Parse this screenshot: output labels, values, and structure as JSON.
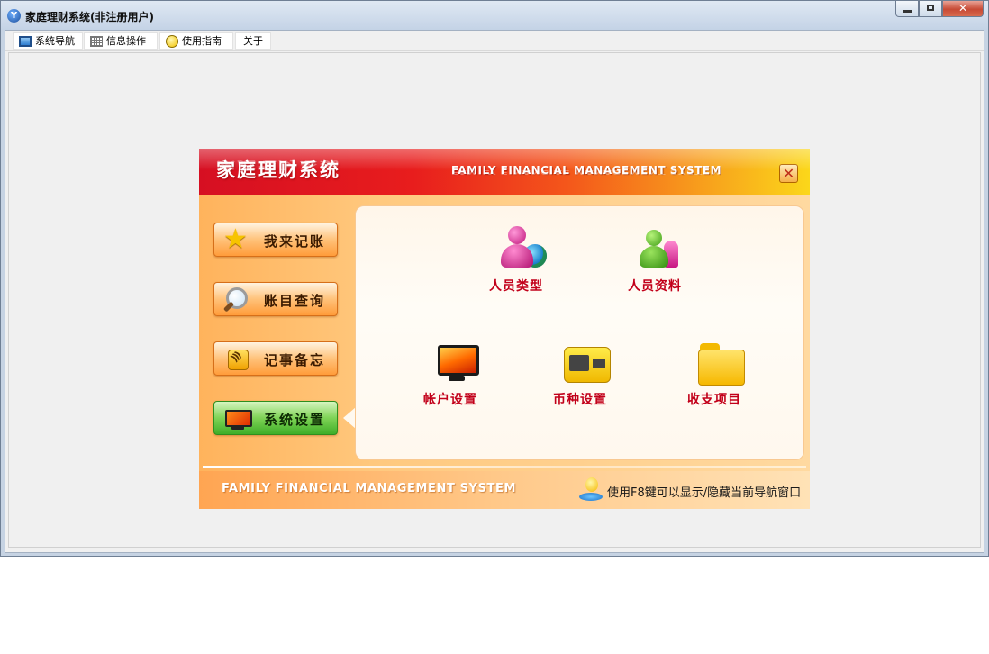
{
  "window": {
    "title": "家庭理财系统(非注册用户)",
    "app_icon_letter": "Y",
    "controls": {
      "minimize": "minimize",
      "maximize": "maximize",
      "close": "✕"
    }
  },
  "menubar": {
    "items": [
      {
        "label": "系统导航",
        "icon": "monitor-icon"
      },
      {
        "label": "信息操作",
        "icon": "grid-icon"
      },
      {
        "label": "使用指南",
        "icon": "smiley-icon"
      },
      {
        "label": "关于",
        "icon": ""
      }
    ]
  },
  "panel": {
    "title": "家庭理财系统",
    "subtitle_en": "FAMILY FINANCIAL MANAGEMENT SYSTEM",
    "close_glyph": "✕",
    "nav": [
      {
        "label": "我来记账",
        "icon": "star-icon",
        "active": false
      },
      {
        "label": "账目查询",
        "icon": "magnifier-icon",
        "active": false
      },
      {
        "label": "记事备忘",
        "icon": "rss-icon",
        "active": false
      },
      {
        "label": "系统设置",
        "icon": "monitor-icon",
        "active": true
      }
    ],
    "tiles": [
      {
        "label": "人员类型",
        "icon": "person-globe-icon"
      },
      {
        "label": "人员资料",
        "icon": "person-group-icon"
      },
      {
        "label": "帐户设置",
        "icon": "monitor-icon"
      },
      {
        "label": "币种设置",
        "icon": "video-camera-icon"
      },
      {
        "label": "收支项目",
        "icon": "folder-icon"
      }
    ],
    "footer_en": "FAMILY FINANCIAL MANAGEMENT SYSTEM",
    "footer_hint": "使用F8键可以显示/隐藏当前导航窗口"
  },
  "colors": {
    "header_left": "#d60f22",
    "header_right": "#fbd71a",
    "label_red": "#c2001a",
    "active_green": "#3fae28"
  }
}
